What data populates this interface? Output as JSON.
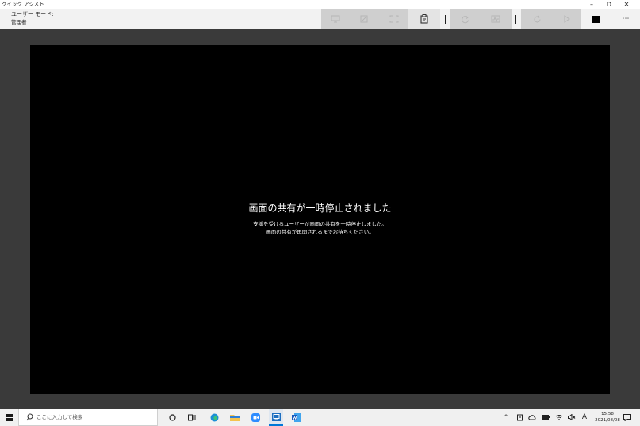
{
  "app": {
    "title": "クイック アシスト"
  },
  "window_controls": {
    "minimize": "–",
    "restore": "ᗞ",
    "close": "✕"
  },
  "header": {
    "mode_label": "ユーザー モード:",
    "mode_value": "管理者"
  },
  "share": {
    "title": "画面の共有が一時停止されました",
    "message_line1": "支援を受けるユーザーが画面の共有を一時停止しました。",
    "message_line2": "画面の共有が再開されるまでお待ちください。"
  },
  "taskbar": {
    "search_placeholder": "ここに入力して検索"
  },
  "tray": {
    "ime": "A",
    "time": "15:58",
    "date": "2021/08/08"
  },
  "colors": {
    "accent": "#0078d7",
    "toolbar_bg": "#f2f2f2",
    "disabled_bg": "#cfcfcf",
    "content_bg": "#000000",
    "frame_bg": "#3a3a3a"
  }
}
